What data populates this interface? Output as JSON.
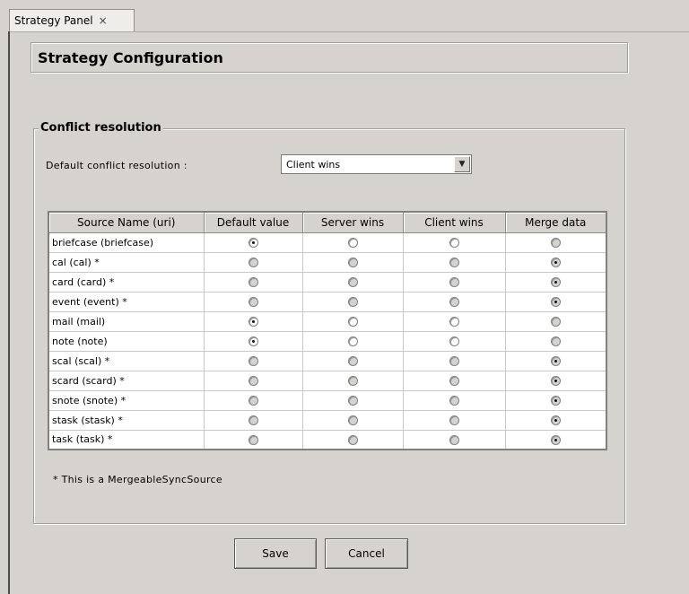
{
  "tab": {
    "label": "Strategy Panel",
    "close_glyph": "×"
  },
  "header": {
    "title": "Strategy Configuration"
  },
  "group": {
    "legend": "Conflict resolution",
    "default_label": "Default conflict resolution :",
    "default_value": "Client wins"
  },
  "table": {
    "columns": [
      "Source Name (uri)",
      "Default value",
      "Server wins",
      "Client wins",
      "Merge data"
    ],
    "rows": [
      {
        "name": "briefcase (briefcase)",
        "selected": 0,
        "enabled": [
          true,
          true,
          true,
          false
        ]
      },
      {
        "name": "cal (cal) *",
        "selected": 3,
        "enabled": [
          false,
          false,
          false,
          false
        ]
      },
      {
        "name": "card (card) *",
        "selected": 3,
        "enabled": [
          false,
          false,
          false,
          false
        ]
      },
      {
        "name": "event (event) *",
        "selected": 3,
        "enabled": [
          false,
          false,
          false,
          false
        ]
      },
      {
        "name": "mail (mail)",
        "selected": 0,
        "enabled": [
          true,
          true,
          true,
          false
        ]
      },
      {
        "name": "note (note)",
        "selected": 0,
        "enabled": [
          true,
          true,
          true,
          false
        ]
      },
      {
        "name": "scal (scal) *",
        "selected": 3,
        "enabled": [
          false,
          false,
          false,
          false
        ]
      },
      {
        "name": "scard (scard) *",
        "selected": 3,
        "enabled": [
          false,
          false,
          false,
          false
        ]
      },
      {
        "name": "snote (snote) *",
        "selected": 3,
        "enabled": [
          false,
          false,
          false,
          false
        ]
      },
      {
        "name": "stask (stask) *",
        "selected": 3,
        "enabled": [
          false,
          false,
          false,
          false
        ]
      },
      {
        "name": "task (task) *",
        "selected": 3,
        "enabled": [
          false,
          false,
          false,
          false
        ]
      }
    ]
  },
  "footnote": "* This is a MergeableSyncSource",
  "buttons": {
    "save": "Save",
    "cancel": "Cancel"
  }
}
